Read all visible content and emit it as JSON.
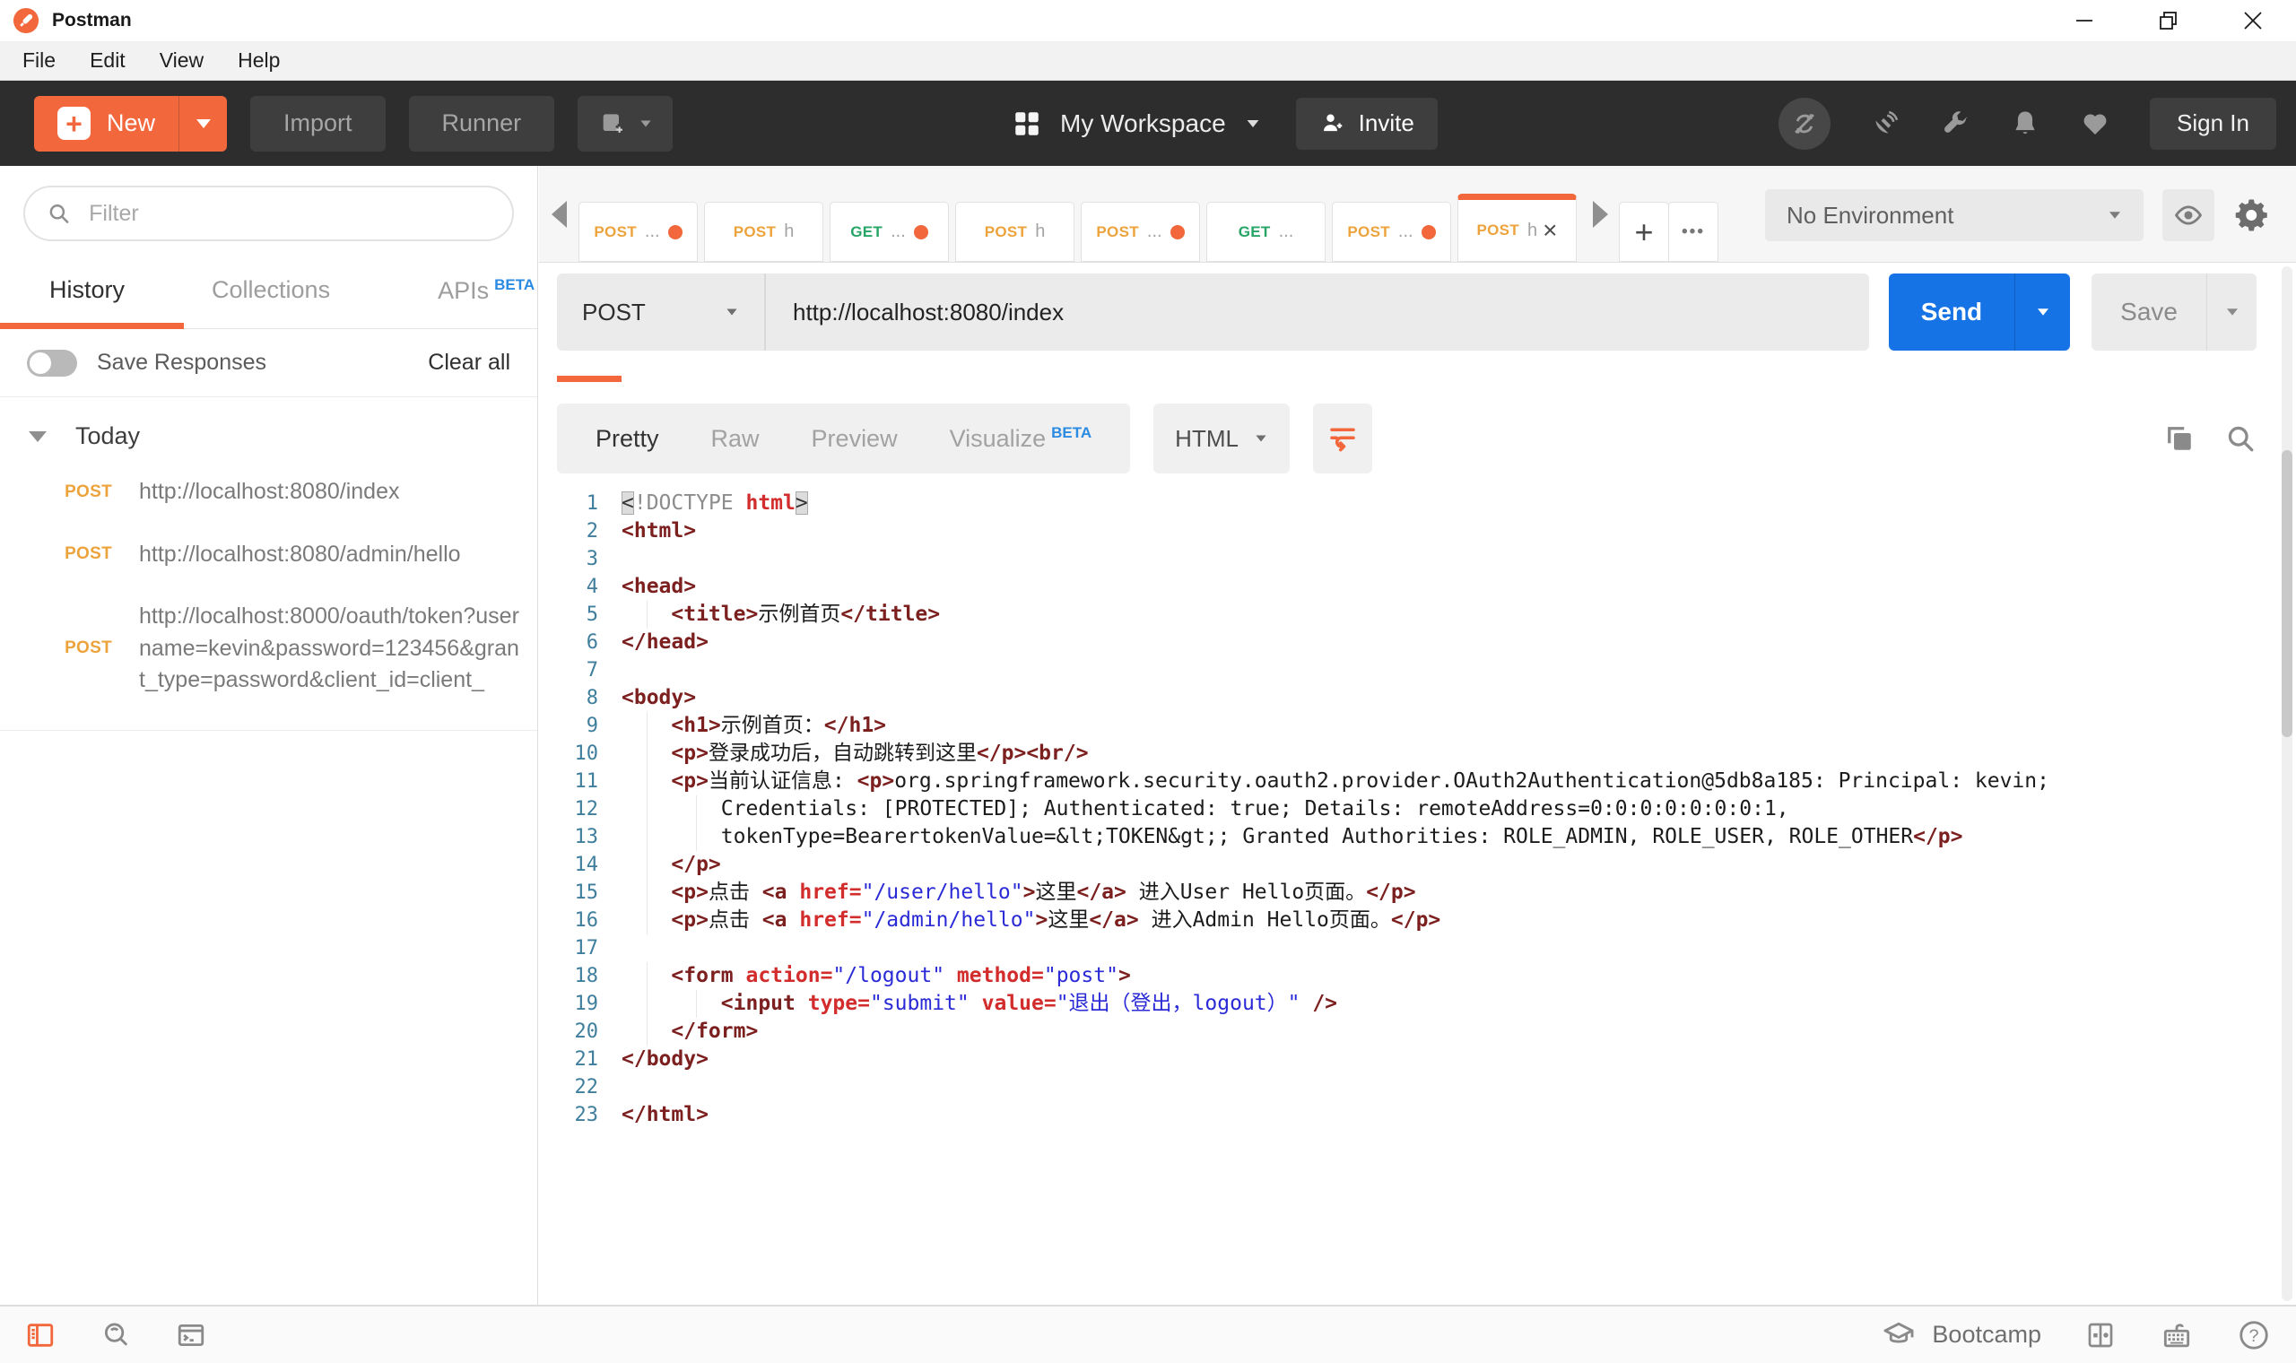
{
  "window": {
    "title": "Postman"
  },
  "menu": {
    "items": [
      "File",
      "Edit",
      "View",
      "Help"
    ]
  },
  "toolbar": {
    "new_label": "New",
    "import_label": "Import",
    "runner_label": "Runner",
    "workspace_label": "My Workspace",
    "invite_label": "Invite",
    "sign_in_label": "Sign In",
    "right_icons": [
      "sync-disabled",
      "satellite",
      "wrench",
      "bell",
      "heart"
    ]
  },
  "sidebar": {
    "filter_placeholder": "Filter",
    "tabs": [
      {
        "label": "History",
        "active": true
      },
      {
        "label": "Collections"
      },
      {
        "label": "APIs",
        "beta": "BETA"
      }
    ],
    "save_responses_label": "Save Responses",
    "clear_all_label": "Clear all",
    "group_label": "Today",
    "history": [
      {
        "method": "POST",
        "url": "http://localhost:8080/index"
      },
      {
        "method": "POST",
        "url": "http://localhost:8080/admin/hello"
      },
      {
        "method": "POST",
        "url": "http://localhost:8000/oauth/token?username=kevin&password=123456&grant_type=password&client_id=client_"
      }
    ]
  },
  "request_tabs": [
    {
      "method": "POST",
      "suffix": "...",
      "dot": true
    },
    {
      "method": "POST",
      "suffix": "h",
      "dot": false
    },
    {
      "method": "GET",
      "suffix": "...",
      "dot": true
    },
    {
      "method": "POST",
      "suffix": "h",
      "dot": false
    },
    {
      "method": "POST",
      "suffix": "...",
      "dot": true
    },
    {
      "method": "GET",
      "suffix": "...",
      "dot": false
    },
    {
      "method": "POST",
      "suffix": "...",
      "dot": true
    },
    {
      "method": "POST",
      "suffix": "h",
      "dot": false,
      "active": true,
      "close": true
    }
  ],
  "environment": {
    "selected": "No Environment"
  },
  "request": {
    "method": "POST",
    "url": "http://localhost:8080/index",
    "send_label": "Send",
    "save_label": "Save"
  },
  "response": {
    "views": [
      "Pretty",
      "Raw",
      "Preview",
      "Visualize"
    ],
    "active_view": "Pretty",
    "beta": "BETA",
    "language": "HTML"
  },
  "editor": {
    "lines": [
      {
        "n": 1,
        "s": [
          [
            "hl",
            "<"
          ],
          [
            "meta",
            "!DOCTYPE "
          ],
          [
            "attr",
            "html"
          ],
          [
            "hl",
            ">"
          ]
        ]
      },
      {
        "n": 2,
        "s": [
          [
            "tag",
            "<html>"
          ]
        ]
      },
      {
        "n": 3,
        "s": []
      },
      {
        "n": 4,
        "s": [
          [
            "tag",
            "<head>"
          ]
        ]
      },
      {
        "n": 5,
        "g": 1,
        "s": [
          [
            "text",
            "    "
          ],
          [
            "tag",
            "<title>"
          ],
          [
            "text",
            "示例首页"
          ],
          [
            "tag",
            "</title>"
          ]
        ]
      },
      {
        "n": 6,
        "s": [
          [
            "tag",
            "</head>"
          ]
        ]
      },
      {
        "n": 7,
        "s": []
      },
      {
        "n": 8,
        "s": [
          [
            "tag",
            "<body>"
          ]
        ]
      },
      {
        "n": 9,
        "g": 1,
        "s": [
          [
            "text",
            "    "
          ],
          [
            "tag",
            "<h1>"
          ],
          [
            "text",
            "示例首页："
          ],
          [
            "tag",
            "</h1>"
          ]
        ]
      },
      {
        "n": 10,
        "g": 1,
        "s": [
          [
            "text",
            "    "
          ],
          [
            "tag",
            "<p>"
          ],
          [
            "text",
            "登录成功后，自动跳转到这里"
          ],
          [
            "tag",
            "</p>"
          ],
          [
            "tag",
            "<br/>"
          ]
        ]
      },
      {
        "n": 11,
        "g": 1,
        "s": [
          [
            "text",
            "    "
          ],
          [
            "tag",
            "<p>"
          ],
          [
            "text",
            "当前认证信息: "
          ],
          [
            "tag",
            "<p>"
          ],
          [
            "text",
            "org.springframework.security.oauth2.provider.OAuth2Authentication@5db8a185: Principal: kevin;"
          ]
        ]
      },
      {
        "n": 12,
        "g": 2,
        "s": [
          [
            "text",
            "        Credentials: [PROTECTED]; Authenticated: true; Details: remoteAddress=0:0:0:0:0:0:0:1,"
          ]
        ]
      },
      {
        "n": 13,
        "g": 2,
        "s": [
          [
            "text",
            "        tokenType=BearertokenValue=&lt;TOKEN&gt;; Granted Authorities: ROLE_ADMIN, ROLE_USER, ROLE_OTHER"
          ],
          [
            "tag",
            "</p>"
          ]
        ]
      },
      {
        "n": 14,
        "g": 1,
        "s": [
          [
            "text",
            "    "
          ],
          [
            "tag",
            "</p>"
          ]
        ]
      },
      {
        "n": 15,
        "g": 1,
        "s": [
          [
            "text",
            "    "
          ],
          [
            "tag",
            "<p>"
          ],
          [
            "text",
            "点击 "
          ],
          [
            "tag",
            "<a "
          ],
          [
            "attr",
            "href="
          ],
          [
            "str",
            "\"/user/hello\""
          ],
          [
            "tag",
            ">"
          ],
          [
            "text",
            "这里"
          ],
          [
            "tag",
            "</a>"
          ],
          [
            "text",
            " 进入User Hello页面。"
          ],
          [
            "tag",
            "</p>"
          ]
        ]
      },
      {
        "n": 16,
        "g": 1,
        "s": [
          [
            "text",
            "    "
          ],
          [
            "tag",
            "<p>"
          ],
          [
            "text",
            "点击 "
          ],
          [
            "tag",
            "<a "
          ],
          [
            "attr",
            "href="
          ],
          [
            "str",
            "\"/admin/hello\""
          ],
          [
            "tag",
            ">"
          ],
          [
            "text",
            "这里"
          ],
          [
            "tag",
            "</a>"
          ],
          [
            "text",
            " 进入Admin Hello页面。"
          ],
          [
            "tag",
            "</p>"
          ]
        ]
      },
      {
        "n": 17,
        "s": []
      },
      {
        "n": 18,
        "g": 1,
        "s": [
          [
            "text",
            "    "
          ],
          [
            "tag",
            "<form "
          ],
          [
            "attr",
            "action="
          ],
          [
            "str",
            "\"/logout\""
          ],
          [
            "text",
            " "
          ],
          [
            "attr",
            "method="
          ],
          [
            "str",
            "\"post\""
          ],
          [
            "tag",
            ">"
          ]
        ]
      },
      {
        "n": 19,
        "g": 2,
        "s": [
          [
            "text",
            "        "
          ],
          [
            "tag",
            "<input "
          ],
          [
            "attr",
            "type="
          ],
          [
            "str",
            "\"submit\""
          ],
          [
            "text",
            " "
          ],
          [
            "attr",
            "value="
          ],
          [
            "str",
            "\"退出（登出，logout）\""
          ],
          [
            "tag",
            " />"
          ]
        ]
      },
      {
        "n": 20,
        "g": 1,
        "s": [
          [
            "text",
            "    "
          ],
          [
            "tag",
            "</form>"
          ]
        ]
      },
      {
        "n": 21,
        "s": [
          [
            "tag",
            "</body>"
          ]
        ]
      },
      {
        "n": 22,
        "s": []
      },
      {
        "n": 23,
        "s": [
          [
            "tag",
            "</html>"
          ]
        ]
      }
    ]
  },
  "statusbar": {
    "bootcamp_label": "Bootcamp"
  },
  "colors": {
    "accent_orange": "#F2683C",
    "post_method": "#EDA33C",
    "get_method": "#26A566",
    "beta_blue": "#2B8AE2",
    "send_blue": "#1673E6",
    "toolbar_dark": "#2D2D2D"
  }
}
